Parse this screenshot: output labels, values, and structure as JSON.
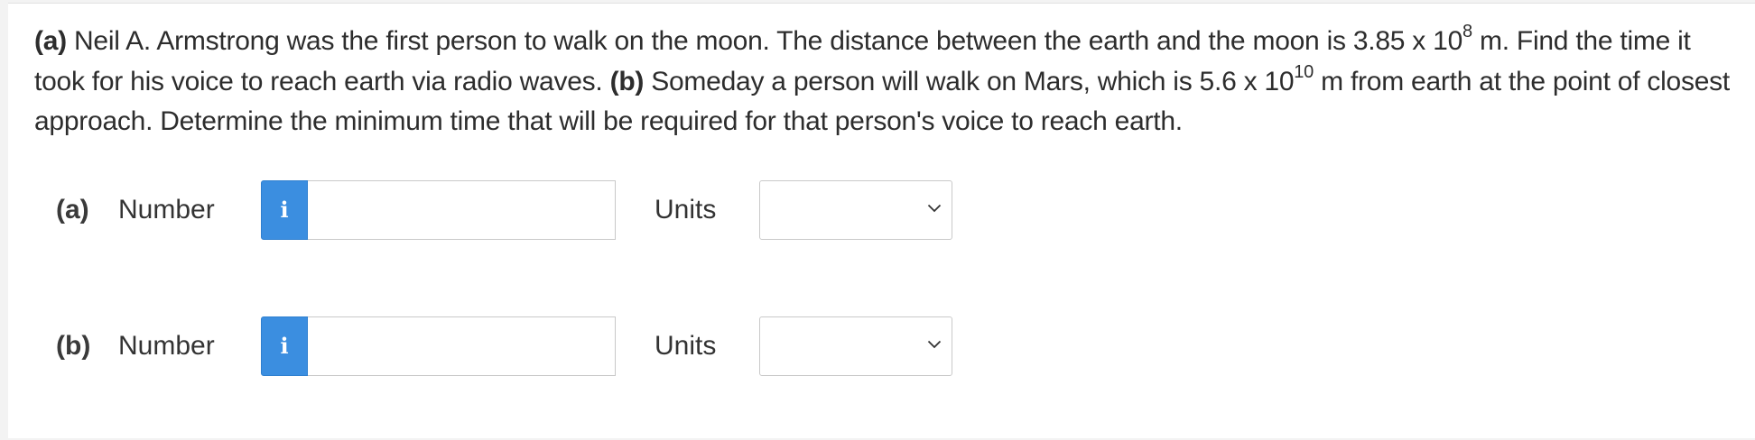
{
  "question": {
    "a_tag": "(a)",
    "a_text": " Neil A. Armstrong was the first person to walk on the moon. The distance between the earth and the moon is 3.85 x 10",
    "a_exp": "8",
    "a_text2": " m. Find the time it took for his voice to reach earth via radio waves. ",
    "b_tag": "(b)",
    "b_text": " Someday a person will walk on Mars, which is 5.6 x 10",
    "b_exp": "10",
    "b_text2": " m from earth at the point of closest approach. Determine the minimum time that will be required for that person's voice to reach earth."
  },
  "parts": [
    {
      "label": "(a)",
      "number_label": "Number",
      "info_icon": "i",
      "number_value": "",
      "units_label": "Units",
      "units_selected": ""
    },
    {
      "label": "(b)",
      "number_label": "Number",
      "info_icon": "i",
      "number_value": "",
      "units_label": "Units",
      "units_selected": ""
    }
  ],
  "colors": {
    "info_button": "#3b8ee0",
    "text": "#2d2d2d",
    "border": "#c9c9c9"
  },
  "icons": {
    "info": "info-icon",
    "dropdown": "chevron-down-icon"
  }
}
